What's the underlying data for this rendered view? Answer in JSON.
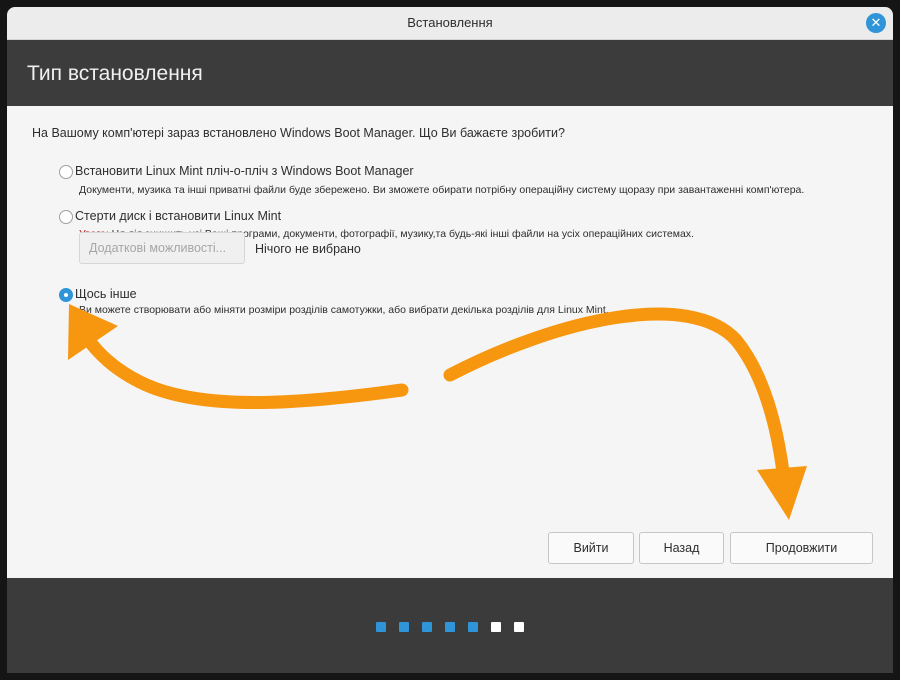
{
  "window": {
    "title": "Встановлення",
    "close_glyph": "✕"
  },
  "header": {
    "title": "Тип встановлення"
  },
  "question": "На Вашому комп'ютері зараз встановлено Windows Boot Manager. Що Ви бажаєте зробити?",
  "options": [
    {
      "label": "Встановити Linux Mint пліч-о-пліч з Windows Boot Manager",
      "description": "Документи, музика та інші приватні файли буде збережено. Ви зможете обирати потрібну операційну систему щоразу при завантаженні комп'ютера.",
      "selected": false
    },
    {
      "label": "Стерти диск і встановити Linux Mint",
      "warning_prefix": "Увага:",
      "description": " Ця дія знищить усі Ваші програми, документи, фотографії, музику,та будь-які інші файли на усіх операційних системах.",
      "advanced_button": "Додаткові можливості...",
      "advanced_status": "Нічого не вибрано",
      "selected": false
    },
    {
      "label": "Щось інше",
      "description": "Ви можете створювати або міняти розміри розділів самотужки, або вибрати декілька розділів для Linux Mint.",
      "selected": true
    }
  ],
  "buttons": {
    "quit": "Вийти",
    "back": "Назад",
    "continue": "Продовжити"
  },
  "progress": {
    "total_steps": 7,
    "completed_steps": 5
  },
  "colors": {
    "accent": "#2f95d8",
    "annotation_arrow": "#f7960f",
    "warning": "#b01717"
  }
}
